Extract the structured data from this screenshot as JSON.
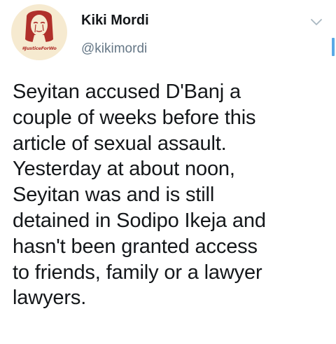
{
  "user": {
    "display_name": "Kiki Mordi",
    "handle": "@kikimordi",
    "avatar_caption": "#JusticeForWo"
  },
  "tweet": {
    "lines": [
      "Seyitan accused D'Banj a",
      "couple of weeks before this",
      "article of sexual assault.",
      "Yesterday at about noon,",
      "Seyitan was and is still",
      "detained in Sodipo Ikeja and",
      "hasn't been granted access",
      "to friends, family or a lawyer",
      "lawyers."
    ]
  },
  "icons": {
    "menu": "chevron-down-icon"
  },
  "colors": {
    "text": "#14171a",
    "secondary": "#657786",
    "accent": "#5aa9e6",
    "avatar_red": "#b0302b"
  }
}
